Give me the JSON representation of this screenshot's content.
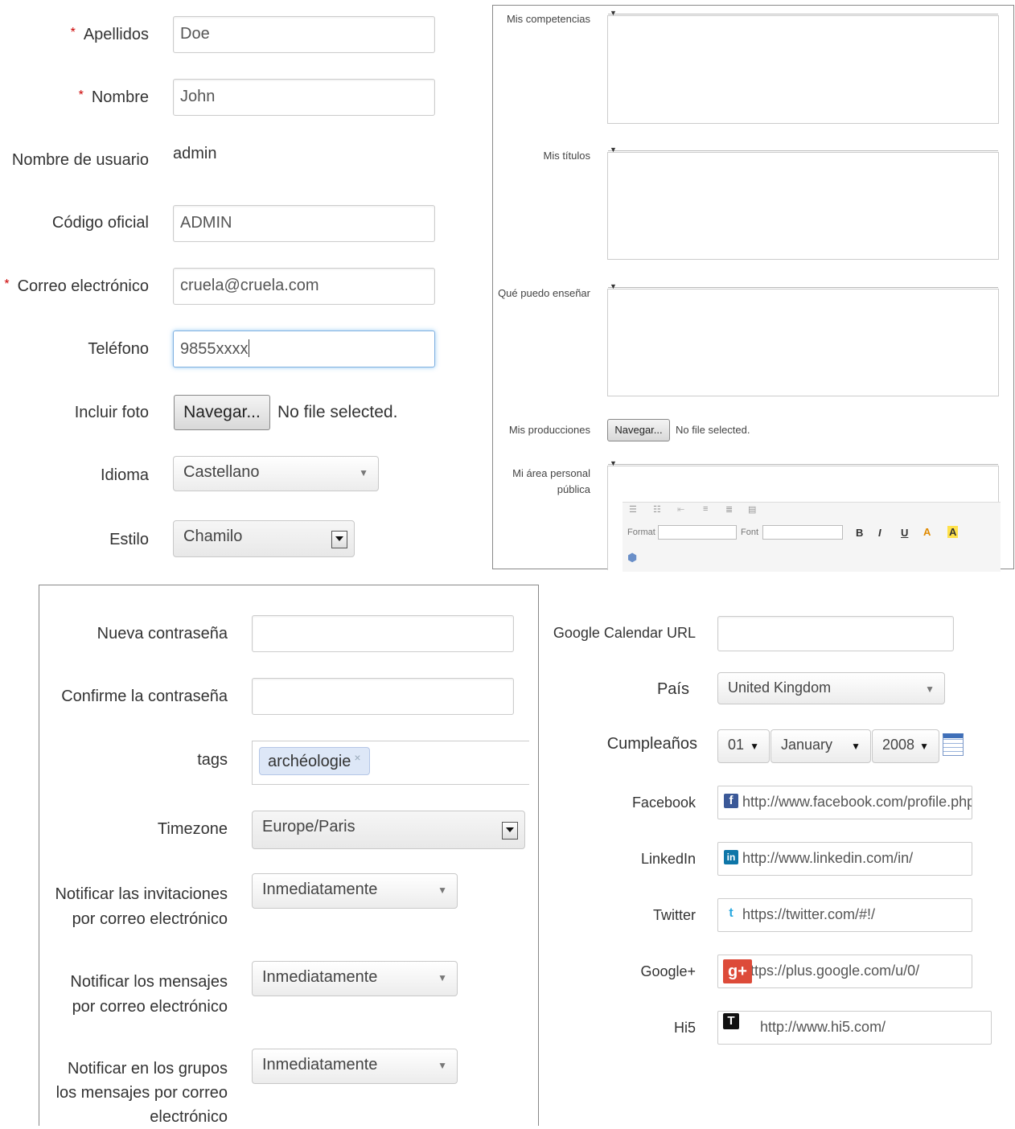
{
  "personal": {
    "apellidos": {
      "label": "Apellidos",
      "value": "Doe",
      "required": "*"
    },
    "nombre": {
      "label": "Nombre",
      "value": "John",
      "required": "*"
    },
    "usuario": {
      "label": "Nombre de usuario",
      "value": "admin"
    },
    "codigo": {
      "label": "Código oficial",
      "value": "ADMIN"
    },
    "correo": {
      "label": "Correo electrónico",
      "value": "cruela@cruela.com",
      "required": "*"
    },
    "telefono": {
      "label": "Teléfono",
      "value": "9855xxxx"
    },
    "foto": {
      "label": "Incluir foto",
      "button": "Navegar...",
      "status": "No file selected."
    },
    "idioma": {
      "label": "Idioma",
      "value": "Castellano"
    },
    "estilo": {
      "label": "Estilo",
      "value": "Chamilo"
    }
  },
  "extended": {
    "competencias": "Mis competencias",
    "titulos": "Mis títulos",
    "ensenar": "Qué puedo enseñar",
    "producciones": {
      "label": "Mis producciones",
      "button": "Navegar...",
      "status": "No file selected."
    },
    "area_personal": "Mi área personal pública",
    "toolbar": {
      "format_label": "Format",
      "font_label": "Font",
      "bold": "B",
      "italic": "I",
      "underline": "U",
      "font_color": "A",
      "bg_color": "A"
    }
  },
  "security": {
    "nueva": {
      "label": "Nueva contraseña",
      "value": ""
    },
    "confirme": {
      "label": "Confirme la contraseña",
      "value": ""
    },
    "tags": {
      "label": "tags",
      "tag": "archéologie",
      "remove": "×"
    },
    "timezone": {
      "label": "Timezone",
      "value": "Europe/Paris"
    },
    "notif_invitaciones": {
      "label_l1": "Notificar las invitaciones",
      "label_l2": "por correo electrónico",
      "value": "Inmediatamente"
    },
    "notif_mensajes": {
      "label_l1": "Notificar los mensajes",
      "label_l2": "por correo electrónico",
      "value": "Inmediatamente"
    },
    "notif_grupos": {
      "label_l1": "Notificar en los grupos",
      "label_l2": "los mensajes por correo",
      "label_l3": "electrónico",
      "value": "Inmediatamente"
    }
  },
  "profile": {
    "calendar": {
      "label": "Google Calendar URL",
      "value": ""
    },
    "pais": {
      "label": "País",
      "value": "United Kingdom"
    },
    "cumple": {
      "label": "Cumpleaños",
      "day": "01",
      "month": "January",
      "year": "2008"
    },
    "facebook": {
      "label": "Facebook",
      "value": "http://www.facebook.com/profile.php",
      "icon": "f"
    },
    "linkedin": {
      "label": "LinkedIn",
      "value": "http://www.linkedin.com/in/",
      "icon": "in"
    },
    "twitter": {
      "label": "Twitter",
      "value": "https://twitter.com/#!/",
      "icon": "t"
    },
    "googleplus": {
      "label": "Google+",
      "value": "https://plus.google.com/u/0/",
      "icon": "g+"
    },
    "hi5": {
      "label": "Hi5",
      "value": "http://www.hi5.com/",
      "icon": "T"
    }
  },
  "colors": {
    "required": "#cc0000",
    "focus": "#7fb0e0",
    "facebook": "#3b5998",
    "linkedin": "#0e76a8",
    "twitter": "#2aa9e0",
    "googleplus": "#dd4b39"
  }
}
